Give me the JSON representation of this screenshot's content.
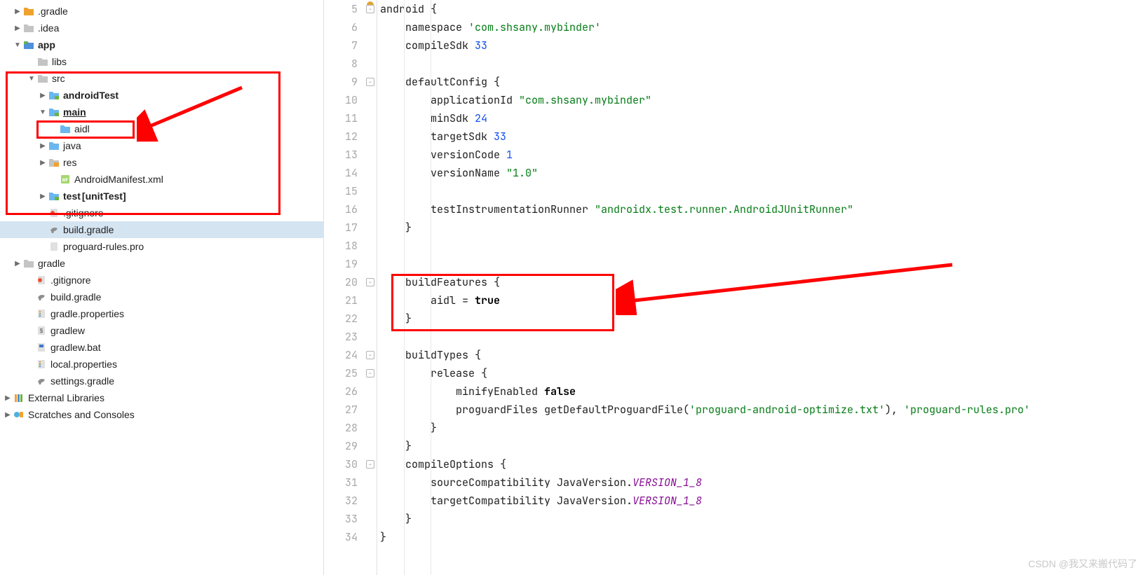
{
  "tree": {
    "gradle_dot": ".gradle",
    "idea": ".idea",
    "app": "app",
    "libs": "libs",
    "src": "src",
    "androidTest": "androidTest",
    "main": "main",
    "aidl": "aidl",
    "java": "java",
    "res": "res",
    "manifest": "AndroidManifest.xml",
    "test": "test",
    "unitTest": "[unitTest]",
    "gitignore_inner": ".gitignore",
    "build_gradle_inner": "build.gradle",
    "proguard": "proguard-rules.pro",
    "gradle_folder": "gradle",
    "gitignore": ".gitignore",
    "build_gradle": "build.gradle",
    "gradle_props": "gradle.properties",
    "gradlew": "gradlew",
    "gradlew_bat": "gradlew.bat",
    "local_props": "local.properties",
    "settings_gradle": "settings.gradle",
    "external_libs": "External Libraries",
    "scratches": "Scratches and Consoles"
  },
  "lines": [
    5,
    6,
    7,
    8,
    9,
    10,
    11,
    12,
    13,
    14,
    15,
    16,
    17,
    18,
    19,
    20,
    21,
    22,
    23,
    24,
    25,
    26,
    27,
    28,
    29,
    30,
    31,
    32,
    33,
    34
  ],
  "code": {
    "l5_a": "android ",
    "l5_b": "{",
    "l6_a": "    namespace ",
    "l6_b": "'com.shsany.mybinder'",
    "l7_a": "    compileSdk ",
    "l7_b": "33",
    "l8": "",
    "l9_a": "    defaultConfig ",
    "l9_b": "{",
    "l10_a": "        applicationId ",
    "l10_b": "\"com.shsany.mybinder\"",
    "l11_a": "        minSdk ",
    "l11_b": "24",
    "l12_a": "        targetSdk ",
    "l12_b": "33",
    "l13_a": "        versionCode ",
    "l13_b": "1",
    "l14_a": "        versionName ",
    "l14_b": "\"1.0\"",
    "l15": "",
    "l16_a": "        testInstrumentationRunner ",
    "l16_b": "\"androidx.test.runner.AndroidJUnitRunner\"",
    "l17": "    }",
    "l18": "",
    "l19": "",
    "l20_a": "    buildFeatures ",
    "l20_b": "{",
    "l21_a": "        aidl ",
    "l21_b": "= ",
    "l21_c": "true",
    "l22": "    }",
    "l23": "",
    "l24_a": "    buildTypes ",
    "l24_b": "{",
    "l25_a": "        release ",
    "l25_b": "{",
    "l26_a": "            minifyEnabled ",
    "l26_b": "false",
    "l27_a": "            proguardFiles getDefaultProguardFile(",
    "l27_b": "'proguard-android-optimize.txt'",
    "l27_c": "), ",
    "l27_d": "'proguard-rules.pro'",
    "l28": "        }",
    "l29": "    }",
    "l30_a": "    compileOptions ",
    "l30_b": "{",
    "l31_a": "        sourceCompatibility JavaVersion.",
    "l31_b": "VERSION_1_8",
    "l32_a": "        targetCompatibility JavaVersion.",
    "l32_b": "VERSION_1_8",
    "l33": "    }",
    "l34": "}"
  },
  "watermark": "CSDN @我又来搬代码了"
}
